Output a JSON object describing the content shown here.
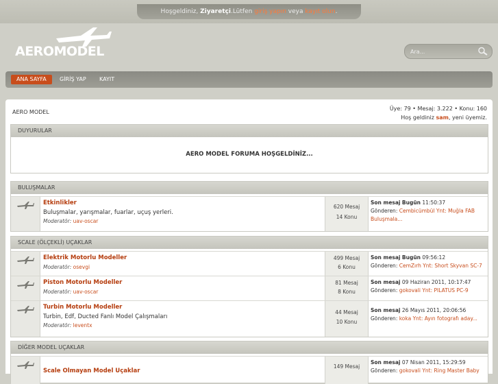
{
  "topbar": {
    "welcome_pre": "Hoşgeldiniz, ",
    "guest": "Ziyaretçi",
    "welcome_mid": ".Lütfen ",
    "login_link": "giriş yapın",
    "or": " veya ",
    "register_link": "kayıt olun",
    "end": "."
  },
  "logo": {
    "text": "AEROMODEL"
  },
  "search": {
    "placeholder": "Ara..."
  },
  "nav": {
    "items": [
      "ANA SAYFA",
      "GİRİŞ YAP",
      "KAYIT"
    ]
  },
  "breadcrumb": "AERO MODEL",
  "stats": {
    "line1": "Üye: 79  •  Mesaj: 3.222  •  Konu: 160",
    "line2_pre": "Hoş geldiniz ",
    "newest": "sam",
    "line2_post": ", yeni üyemiz."
  },
  "duyurular": {
    "header": "DUYURULAR",
    "message": "AERO MODEL FORUMA HOŞGELDİNİZ..."
  },
  "sections": [
    {
      "header": "BULUŞMALAR",
      "forums": [
        {
          "title": "Etkinlikler",
          "desc": "Buluşmalar, yarışmalar, fuarlar, uçuş yerleri.",
          "mod_label": "Moderatör:",
          "mod": "uav-oscar",
          "posts": "620 Mesaj",
          "topics": "14 Konu",
          "last_label": "Son mesaj",
          "last_date": "Bugün",
          "last_time": "11:50:37",
          "by_label": "Gönderen:",
          "by_text": "Cembicümbül Ynt: Muğla FAB Buluşmala..."
        }
      ]
    },
    {
      "header": "SCALE (ÖLÇEKLİ) UÇAKLAR",
      "forums": [
        {
          "title": "Elektrik Motorlu Modeller",
          "desc": "",
          "mod_label": "Moderatör:",
          "mod": "osevgi",
          "posts": "499 Mesaj",
          "topics": "6 Konu",
          "last_label": "Son mesaj",
          "last_date": "Bugün",
          "last_time": "09:56:12",
          "by_label": "Gönderen:",
          "by_text": "CemZırh Ynt: Short Skyvan SC-7"
        },
        {
          "title": "Piston Motorlu Modeller",
          "desc": "",
          "mod_label": "Moderatör:",
          "mod": "uav-oscar",
          "posts": "81 Mesaj",
          "topics": "8 Konu",
          "last_label": "Son mesaj",
          "last_date": "",
          "last_time": "09 Haziran 2011, 10:17:47",
          "by_label": "Gönderen:",
          "by_text": "gokovali Ynt: PILATUS PC-9"
        },
        {
          "title": "Turbin Motorlu Modeller",
          "desc": "Turbin, Edf, Ducted Fanlı Model Çalışmaları",
          "mod_label": "Moderatör:",
          "mod": "leventx",
          "posts": "44 Mesaj",
          "topics": "10 Konu",
          "last_label": "Son mesaj",
          "last_date": "",
          "last_time": "26 Mayıs 2011, 20:06:56",
          "by_label": "Gönderen:",
          "by_text": "koka Ynt: Ayın fotografı aday..."
        }
      ]
    },
    {
      "header": "DİĞER MODEL UÇAKLAR",
      "forums": [
        {
          "title": "Scale Olmayan Model Uçaklar",
          "desc": "",
          "mod_label": "",
          "mod": "",
          "posts": "149 Mesaj",
          "topics": "",
          "last_label": "Son mesaj",
          "last_date": "",
          "last_time": "07 Nisan 2011, 15:29:59",
          "by_label": "Gönderen:",
          "by_text": "gokovali Ynt: Ring Master Baby"
        }
      ]
    }
  ]
}
